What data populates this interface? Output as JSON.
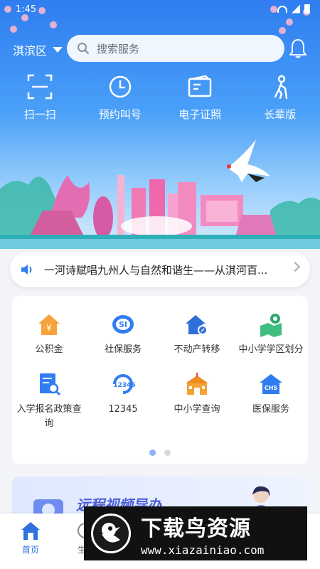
{
  "status_bar": {
    "time": "1:45"
  },
  "header": {
    "district": "淇滨区",
    "search_placeholder": "搜索服务"
  },
  "quick_actions": [
    {
      "label": "扫一扫",
      "icon": "scan-icon"
    },
    {
      "label": "预约叫号",
      "icon": "clock-icon"
    },
    {
      "label": "电子证照",
      "icon": "card-icon"
    },
    {
      "label": "长辈版",
      "icon": "elder-icon"
    }
  ],
  "notice": {
    "text": "一河诗赋唱九州人与自然和谐生——从淇河百..."
  },
  "services": [
    {
      "label": "公积金",
      "icon": "housing-fund-icon"
    },
    {
      "label": "社保服务",
      "icon": "social-security-icon"
    },
    {
      "label": "不动产转移",
      "icon": "real-estate-icon"
    },
    {
      "label": "中小学学区划分",
      "icon": "school-district-map-icon"
    },
    {
      "label": "入学报名政策查询",
      "icon": "enrollment-search-icon"
    },
    {
      "label": "12345",
      "icon": "hotline-12345-icon"
    },
    {
      "label": "中小学查询",
      "icon": "school-icon"
    },
    {
      "label": "医保服务",
      "icon": "medical-insurance-icon"
    }
  ],
  "pagination": {
    "pages": 2,
    "active": 1
  },
  "banner": {
    "title": "远程视频导办"
  },
  "tabs": [
    {
      "label": "首页",
      "active": true
    },
    {
      "label": "生",
      "active": false
    }
  ],
  "watermark": {
    "title": "下载鸟资源",
    "url": "www.xiazainiao.com"
  },
  "colors": {
    "primary": "#2f7df0",
    "active_tab": "#2f6fe0",
    "notice_icon": "#2f7df0"
  }
}
